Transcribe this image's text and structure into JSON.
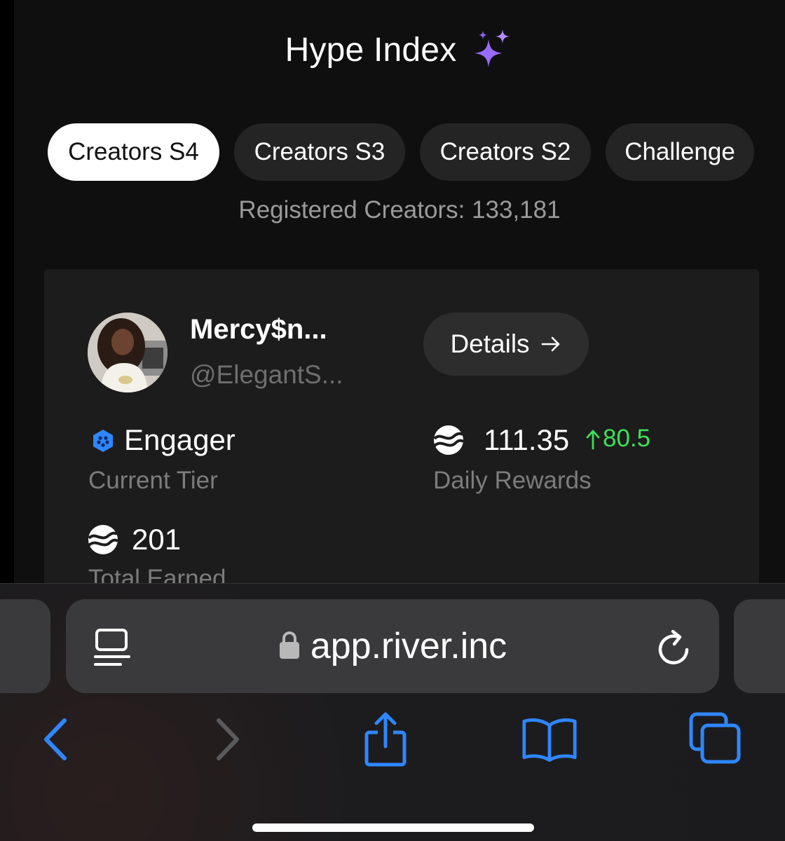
{
  "page": {
    "title": "Hype Index",
    "tabs": [
      {
        "label": "Creators S4",
        "active": true
      },
      {
        "label": "Creators S3",
        "active": false
      },
      {
        "label": "Creators S2",
        "active": false
      },
      {
        "label": "Challenge",
        "active": false
      }
    ],
    "registered_creators": "Registered Creators: 133,181"
  },
  "card": {
    "name": "Mercy$n...",
    "handle": "@ElegantS...",
    "details_label": "Details",
    "tier": {
      "value": "Engager",
      "label": "Current Tier"
    },
    "daily_rewards": {
      "value": "111.35",
      "delta": "80.5",
      "label": "Daily Rewards"
    },
    "total_earned": {
      "value": "201",
      "label": "Total Earned"
    }
  },
  "browser": {
    "url": "app.river.inc"
  },
  "colors": {
    "accent_blue": "#2f86ff",
    "positive_green": "#3ce05a",
    "sparkle_purple": "#9b6bff"
  },
  "icons": [
    "sparkle-icon",
    "arrow-right-icon",
    "tier-badge-icon",
    "river-coin-icon",
    "reader-mode-icon",
    "lock-icon",
    "reload-icon",
    "back-icon",
    "forward-icon",
    "share-icon",
    "bookmarks-icon",
    "tabs-icon"
  ]
}
